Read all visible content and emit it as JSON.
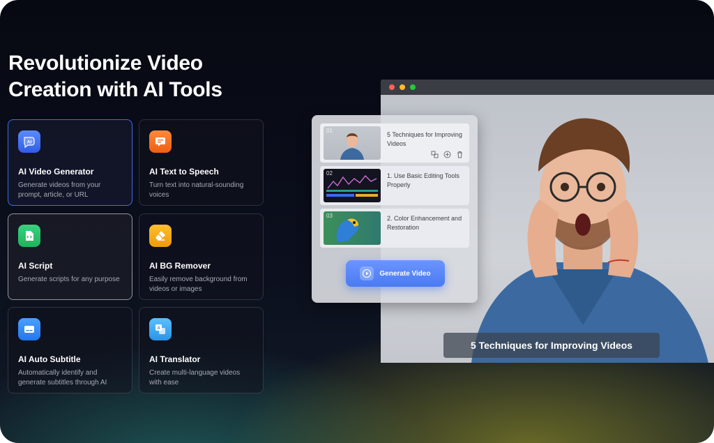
{
  "headline": {
    "line1": "Revolutionize Video",
    "line2": "Creation with AI Tools"
  },
  "tools": [
    {
      "title": "AI Video Generator",
      "desc": "Generate videos from your prompt, article, or URL",
      "icon": "ai-video-icon",
      "color": "#3b6bf0"
    },
    {
      "title": "AI Text to Speech",
      "desc": "Turn text into natural-sounding voices",
      "icon": "speech-bubble-icon",
      "color": "#f26b1d"
    },
    {
      "title": "AI Script",
      "desc": "Generate scripts for any purpose",
      "icon": "code-file-icon",
      "color": "#28c46b"
    },
    {
      "title": "AI BG Remover",
      "desc": "Easily remove background from videos or images",
      "icon": "eraser-icon",
      "color": "#f2a516"
    },
    {
      "title": "AI Auto Subtitle",
      "desc": "Automatically identify and generate subtitles through AI",
      "icon": "subtitle-icon",
      "color": "#2f86f5"
    },
    {
      "title": "AI Translator",
      "desc": "Create multi-language videos with ease",
      "icon": "translate-icon",
      "color": "#3aa8f0"
    }
  ],
  "panel": {
    "segments": [
      {
        "num": "01",
        "text": "5 Techniques for Improving Videos"
      },
      {
        "num": "02",
        "text": "1. Use Basic Editing Tools Properly"
      },
      {
        "num": "03",
        "text": "2. Color Enhancement and Restoration"
      }
    ],
    "generate_label": "Generate Video"
  },
  "preview": {
    "caption": "5 Techniques for Improving Videos"
  },
  "colors": {
    "accent": "#4a7af2",
    "dot_red": "#ff5f57",
    "dot_yellow": "#febc2e",
    "dot_green": "#28c840"
  }
}
